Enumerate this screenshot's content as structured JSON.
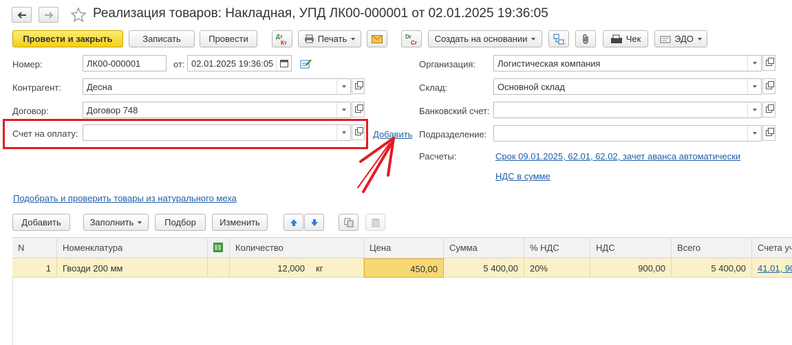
{
  "window": {
    "title": "Реализация товаров: Накладная, УПД ЛК00-000001 от 02.01.2025 19:36:05",
    "back_icon": "arrow-left-icon",
    "forward_icon": "arrow-right-icon",
    "favorite_icon": "star-icon"
  },
  "toolbar": {
    "post_close": "Провести и закрыть",
    "save": "Записать",
    "post": "Провести",
    "dt_kt_icon": "Дт Кт",
    "print": "Печать",
    "mail_icon": "envelope-icon",
    "dr_cr_icon": "Dr Cr",
    "create_based": "Создать на основании",
    "check": "Чек",
    "edo": "ЭДО"
  },
  "form": {
    "number_label": "Номер:",
    "number_value": "ЛК00-000001",
    "date_label": "от:",
    "date_value": "02.01.2025 19:36:05",
    "contractor_label": "Контрагент:",
    "contractor_value": "Десна",
    "contract_label": "Договор:",
    "contract_value": "Договор 748",
    "invoice_label": "Счет на оплату:",
    "invoice_value": "",
    "add_link": "Добавить",
    "organization_label": "Организация:",
    "organization_value": "Логистическая компания",
    "warehouse_label": "Склад:",
    "warehouse_value": "Основной склад",
    "bank_label": "Банковский счет:",
    "bank_value": "",
    "division_label": "Подразделение:",
    "division_value": "",
    "settlements_label": "Расчеты:",
    "settlements_link": "Срок 09.01.2025, 62.01, 62.02, зачет аванса автоматически",
    "vat_link": "НДС в сумме",
    "pick_goods_link": "Подобрать и проверить товары из натурального меха"
  },
  "table_toolbar": {
    "add": "Добавить",
    "fill": "Заполнить",
    "selection": "Подбор",
    "change": "Изменить"
  },
  "table": {
    "columns": [
      "N",
      "Номенклатура",
      "Количество",
      "Цена",
      "Сумма",
      "% НДС",
      "НДС",
      "Всего",
      "Счета уч"
    ],
    "rows": [
      {
        "n": "1",
        "item": "Гвозди 200 мм",
        "qty": "12,000",
        "unit": "кг",
        "price": "450,00",
        "sum": "5 400,00",
        "vat_rate": "20%",
        "vat": "900,00",
        "total": "5 400,00",
        "accounts": "41.01, 90"
      }
    ]
  },
  "colors": {
    "highlight_box": "#e31b23",
    "arrow": "#e31b23",
    "primary_button": "#f4d32a",
    "row_selected": "#fbf1c8",
    "link": "#1f5fa6"
  }
}
